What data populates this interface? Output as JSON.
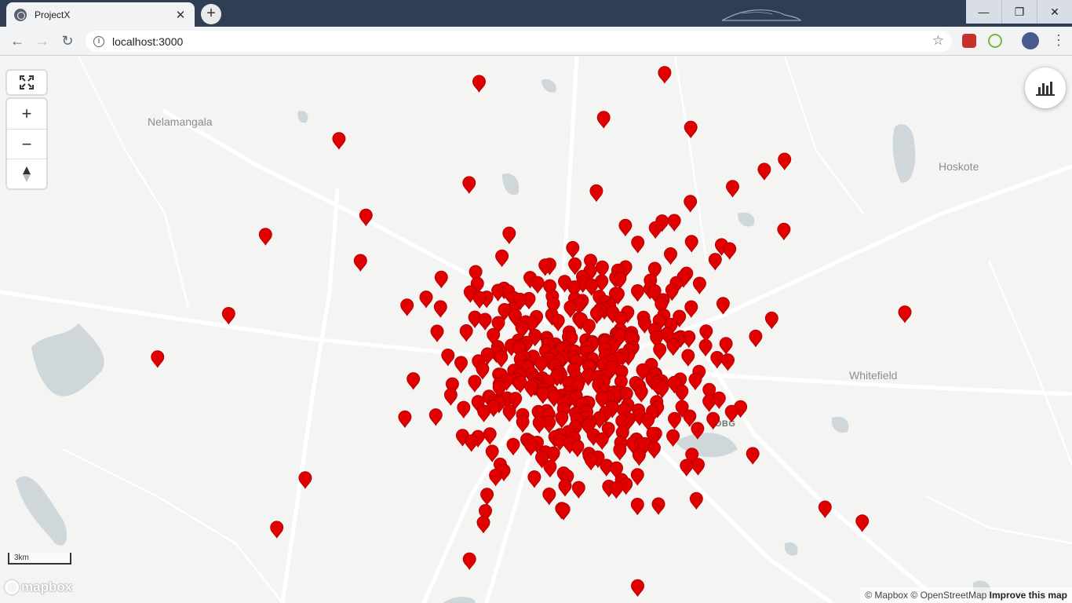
{
  "browser": {
    "tab_title": "ProjectX",
    "tab_close": "✕",
    "new_tab": "+",
    "url": "localhost:3000",
    "window_controls": {
      "minimize": "—",
      "restore": "❐",
      "close": "✕"
    },
    "icons": {
      "back": "arrow-left-icon",
      "forward": "arrow-right-icon",
      "reload": "reload-icon",
      "info": "info-icon",
      "bookmark": "star-icon",
      "menu": "kebab-menu-icon"
    }
  },
  "map": {
    "places": [
      "Nelamangala",
      "Hoskote",
      "Whitefield",
      "VOBG"
    ],
    "controls": {
      "fullscreen": "fullscreen-icon",
      "zoom_in": "+",
      "zoom_out": "−",
      "compass": "compass-icon"
    },
    "stats_button": "bar-chart-icon",
    "scale_label": "3km",
    "logo": "mapbox",
    "attribution": {
      "mapbox": "© Mapbox",
      "osm": "© OpenStreetMap",
      "improve": "Improve this map"
    },
    "marker_color": "#e00000",
    "marker_count": 420
  }
}
